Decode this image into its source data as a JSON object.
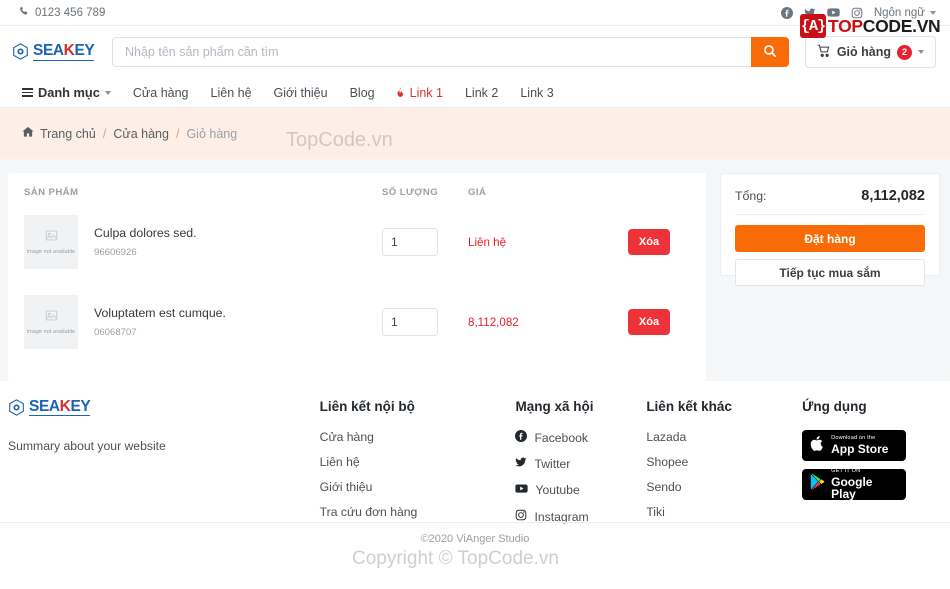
{
  "topbar": {
    "phone": "0123 456 789",
    "phone_icon": "phone-icon",
    "social": [
      "facebook-icon",
      "twitter-icon",
      "youtube-icon",
      "instagram-icon"
    ],
    "language_label": "Ngôn ngữ"
  },
  "header": {
    "logo": {
      "part1": "SEA",
      "part2": "K",
      "part3": "EY",
      "icon": "hexagon-logo-icon"
    },
    "search_placeholder": "Nhập tên sản phẩm cần tìm",
    "search_value": "",
    "search_icon": "search-icon",
    "cart_label": "Giỏ hàng",
    "cart_count": "2",
    "cart_icon": "shopping-cart-icon"
  },
  "nav": {
    "category_label": "Danh mục",
    "items": [
      {
        "label": "Cửa hàng",
        "hot": false
      },
      {
        "label": "Liên hệ",
        "hot": false
      },
      {
        "label": "Giới thiệu",
        "hot": false
      },
      {
        "label": "Blog",
        "hot": false
      },
      {
        "label": "Link 1",
        "hot": true
      },
      {
        "label": "Link 2",
        "hot": false
      },
      {
        "label": "Link 3",
        "hot": false
      }
    ]
  },
  "breadcrumb": {
    "home_icon": "home-icon",
    "items": [
      "Trang chủ",
      "Cửa hàng",
      "Giỏ hàng"
    ],
    "separator": "/"
  },
  "cart": {
    "headers": {
      "product": "SẢN PHẨM",
      "quantity": "SỐ LƯỢNG",
      "price": "GIÁ"
    },
    "delete_label": "Xóa",
    "placeholder_text": "image not available",
    "rows": [
      {
        "name": "Culpa dolores sed.",
        "sku": "96606926",
        "qty": "1",
        "price": "Liên hệ"
      },
      {
        "name": "Voluptatem est cumque.",
        "sku": "06068707",
        "qty": "1",
        "price": "8,112,082"
      }
    ]
  },
  "summary": {
    "total_label": "Tổng:",
    "total_value": "8,112,082",
    "order_label": "Đặt hàng",
    "continue_label": "Tiếp tục mua sắm"
  },
  "footer": {
    "logo": {
      "part1": "SEA",
      "part2": "K",
      "part3": "EY"
    },
    "summary_text": "Summary about your website",
    "col_internal": {
      "title": "Liên kết nội bộ",
      "links": [
        "Cửa hàng",
        "Liên hệ",
        "Giới thiệu",
        "Tra cứu đơn hàng"
      ]
    },
    "col_social": {
      "title": "Mạng xã hội",
      "links": [
        {
          "label": "Facebook",
          "icon": "facebook-icon"
        },
        {
          "label": "Twitter",
          "icon": "twitter-icon"
        },
        {
          "label": "Youtube",
          "icon": "youtube-icon"
        },
        {
          "label": "Instagram",
          "icon": "instagram-icon"
        }
      ]
    },
    "col_other": {
      "title": "Liên kết khác",
      "links": [
        "Lazada",
        "Shopee",
        "Sendo",
        "Tiki"
      ]
    },
    "col_apps": {
      "title": "Ứng dụng",
      "appstore": {
        "small": "Download on the",
        "big": "App Store",
        "icon": "apple-icon"
      },
      "googleplay": {
        "small": "GET IT ON",
        "big": "Google Play",
        "icon": "google-play-icon"
      }
    },
    "copyright": "©2020 ViAnger Studio"
  },
  "watermarks": {
    "breadcrumb_text": "TopCode.vn",
    "copyright_text": "Copyright © TopCode.vn",
    "logo_brace": "{A}",
    "logo_top": "TOP",
    "logo_code": "CODE.VN"
  },
  "colors": {
    "orange": "#f96b07",
    "red": "#ee3239",
    "blue": "#1a63b8",
    "peach": "#fdefe6"
  }
}
